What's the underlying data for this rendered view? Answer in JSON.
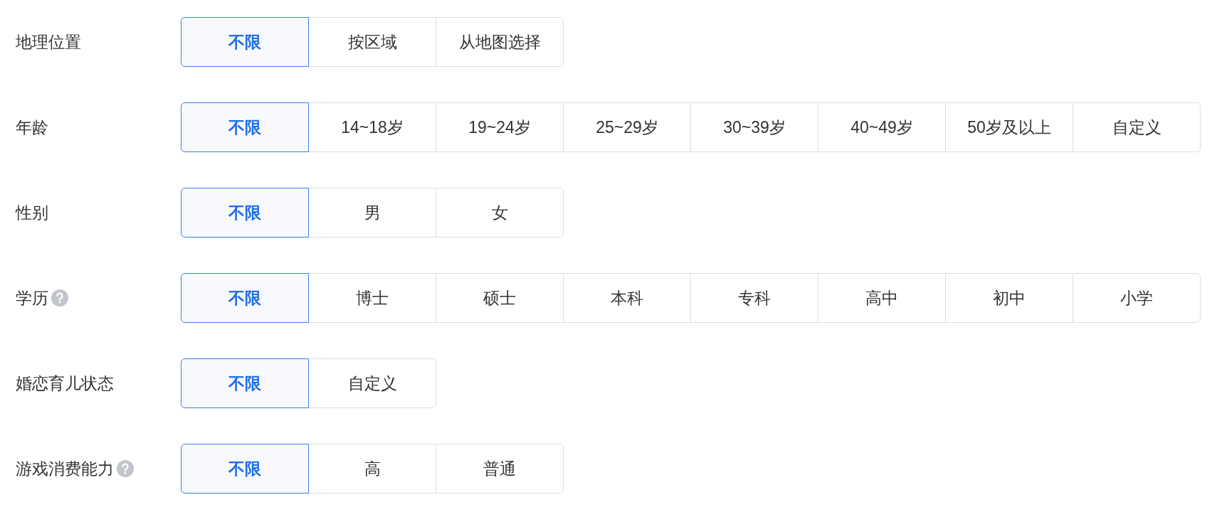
{
  "filters": [
    {
      "label": "地理位置",
      "help": false,
      "options": [
        {
          "label": "不限",
          "selected": true
        },
        {
          "label": "按区域",
          "selected": false
        },
        {
          "label": "从地图选择",
          "selected": false
        }
      ]
    },
    {
      "label": "年龄",
      "help": false,
      "options": [
        {
          "label": "不限",
          "selected": true
        },
        {
          "label": "14~18岁",
          "selected": false
        },
        {
          "label": "19~24岁",
          "selected": false
        },
        {
          "label": "25~29岁",
          "selected": false
        },
        {
          "label": "30~39岁",
          "selected": false
        },
        {
          "label": "40~49岁",
          "selected": false
        },
        {
          "label": "50岁及以上",
          "selected": false
        },
        {
          "label": "自定义",
          "selected": false
        }
      ]
    },
    {
      "label": "性别",
      "help": false,
      "options": [
        {
          "label": "不限",
          "selected": true
        },
        {
          "label": "男",
          "selected": false
        },
        {
          "label": "女",
          "selected": false
        }
      ]
    },
    {
      "label": "学历",
      "help": true,
      "options": [
        {
          "label": "不限",
          "selected": true
        },
        {
          "label": "博士",
          "selected": false
        },
        {
          "label": "硕士",
          "selected": false
        },
        {
          "label": "本科",
          "selected": false
        },
        {
          "label": "专科",
          "selected": false
        },
        {
          "label": "高中",
          "selected": false
        },
        {
          "label": "初中",
          "selected": false
        },
        {
          "label": "小学",
          "selected": false
        }
      ]
    },
    {
      "label": "婚恋育儿状态",
      "help": false,
      "options": [
        {
          "label": "不限",
          "selected": true
        },
        {
          "label": "自定义",
          "selected": false
        }
      ]
    },
    {
      "label": "游戏消费能力",
      "help": true,
      "options": [
        {
          "label": "不限",
          "selected": true
        },
        {
          "label": "高",
          "selected": false
        },
        {
          "label": "普通",
          "selected": false
        }
      ]
    }
  ]
}
